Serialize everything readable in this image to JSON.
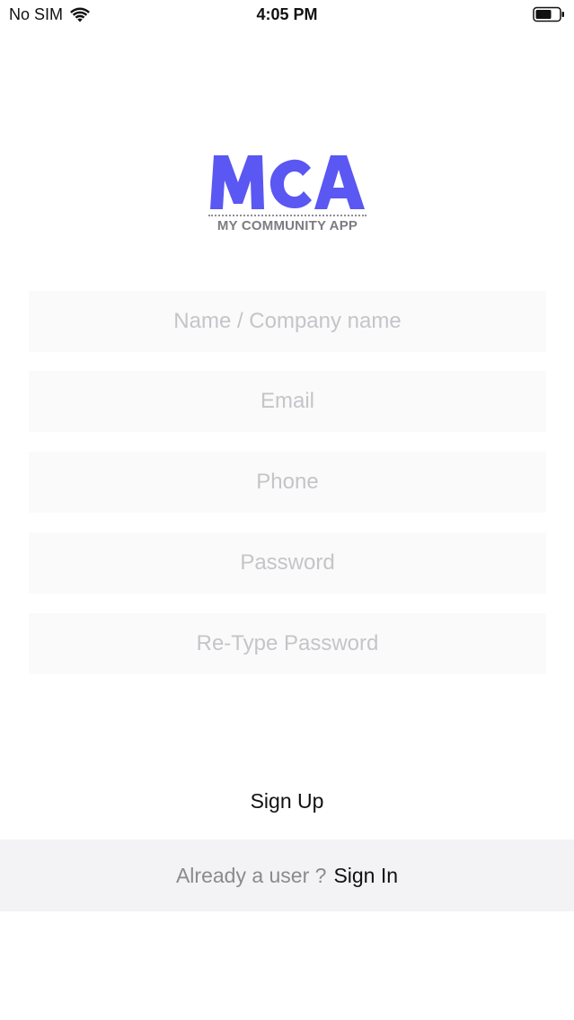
{
  "status_bar": {
    "carrier": "No SIM",
    "time": "4:05 PM",
    "wifi_icon": "wifi-icon",
    "battery_icon": "battery-icon"
  },
  "logo": {
    "mark": "MCA",
    "tagline": "MY COMMUNITY APP",
    "brand_color": "#5a57f2"
  },
  "form": {
    "name_placeholder": "Name / Company name",
    "name_value": "",
    "email_placeholder": "Email",
    "email_value": "",
    "phone_placeholder": "Phone",
    "phone_value": "",
    "password_placeholder": "Password",
    "password_value": "",
    "retype_password_placeholder": "Re-Type Password",
    "retype_password_value": ""
  },
  "actions": {
    "signup_label": "Sign Up",
    "signin_prompt": "Already a user ?",
    "signin_label": "Sign In"
  }
}
